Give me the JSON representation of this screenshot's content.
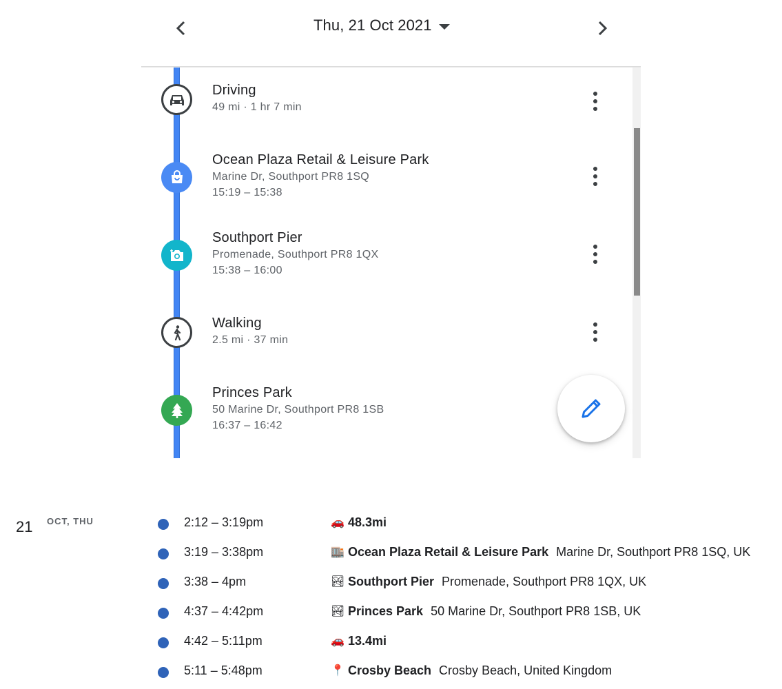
{
  "header": {
    "date": "Thu, 21 Oct 2021"
  },
  "timeline": [
    {
      "type": "movement",
      "icon": "car-icon",
      "title": "Driving",
      "line1": "49 mi · 1 hr 7 min"
    },
    {
      "type": "place",
      "icon": "shopping-bag-icon",
      "color": "#4a8af4",
      "title": "Ocean Plaza Retail & Leisure Park",
      "line1": "Marine Dr, Southport PR8 1SQ",
      "line2": "15:19 – 15:38"
    },
    {
      "type": "place",
      "icon": "camera-icon",
      "color": "#12b5cb",
      "title": "Southport Pier",
      "line1": "Promenade, Southport PR8 1QX",
      "line2": "15:38 – 16:00"
    },
    {
      "type": "movement",
      "icon": "walking-icon",
      "title": "Walking",
      "line1": "2.5 mi · 37 min"
    },
    {
      "type": "place",
      "icon": "tree-icon",
      "color": "#34a853",
      "title": "Princes Park",
      "line1": "50 Marine Dr, Southport PR8 1SB",
      "line2": "16:37 – 16:42"
    }
  ],
  "fab": {
    "icon": "pencil-icon",
    "color": "#1a73e8"
  },
  "list": {
    "day_number": "21",
    "day_label": "OCT, THU",
    "rows": [
      {
        "time": "2:12 – 3:19pm",
        "emoji": "🚗",
        "name": "48.3mi",
        "address": ""
      },
      {
        "time": "3:19 – 3:38pm",
        "emoji": "🏬",
        "name": "Ocean Plaza Retail & Leisure Park",
        "address": "Marine Dr, Southport PR8 1SQ, UK"
      },
      {
        "time": "3:38 – 4pm",
        "emoji": "🏞",
        "name": "Southport Pier",
        "address": "Promenade, Southport PR8 1QX, UK"
      },
      {
        "time": "4:37 – 4:42pm",
        "emoji": "🏞",
        "name": "Princes Park",
        "address": "50 Marine Dr, Southport PR8 1SB, UK"
      },
      {
        "time": "4:42 – 5:11pm",
        "emoji": "🚗",
        "name": "13.4mi",
        "address": ""
      },
      {
        "time": "5:11 – 5:48pm",
        "emoji": "📍",
        "name": "Crosby Beach",
        "address": "Crosby Beach, United Kingdom"
      }
    ]
  }
}
